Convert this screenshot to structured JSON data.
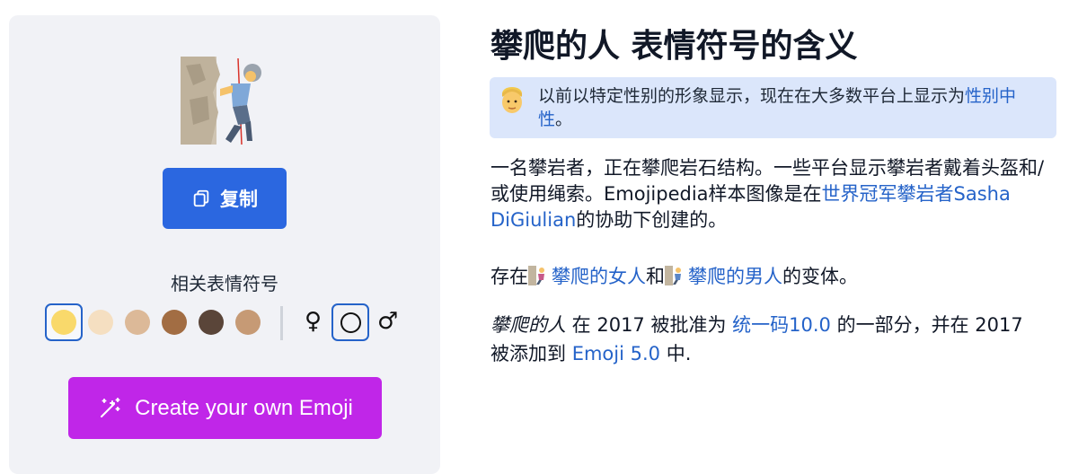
{
  "emoji": {
    "name": "攀爬的人",
    "icon": "person-climbing-icon"
  },
  "copy_button": {
    "label": "复制",
    "icon": "copy-icon"
  },
  "related": {
    "title": "相关表情符号",
    "skin_tones": [
      {
        "color": "#f9d96b",
        "selected": true
      },
      {
        "color": "#f5dfc1",
        "selected": false
      },
      {
        "color": "#dcb998",
        "selected": false
      },
      {
        "color": "#a26d43",
        "selected": false
      },
      {
        "color": "#5a4539",
        "selected": false
      },
      {
        "color": "#c69a75",
        "selected": false
      }
    ],
    "gender_female": "♀",
    "gender_male": "♂"
  },
  "create_button": {
    "label": "Create your own Emoji",
    "icon": "magic-wand-icon"
  },
  "page": {
    "title": "攀爬的人 表情符号的含义"
  },
  "notice": {
    "icon": "person-face-icon",
    "text": "以前以特定性别的形象显示，现在在大多数平台上显示为",
    "link": "性别中性",
    "tail": "。"
  },
  "description": {
    "text1": "一名攀岩者，正在攀爬岩石结构。一些平台显示攀岩者戴着头盔和/或使用绳索。Emojipedia样本图像是在",
    "link": "世界冠军攀岩者Sasha DiGiulian",
    "text2": "的协助下创建的。"
  },
  "variants": {
    "prefix": "存在",
    "woman_link": "攀爬的女人",
    "middle": "和",
    "man_link": "攀爬的男人",
    "suffix": "的变体。"
  },
  "approved": {
    "name": "攀爬的人",
    "t1": " 在 2017 被批准为 ",
    "unicode_link": "统一码10.0",
    "t2": " 的一部分，并在 2017 被添加到 ",
    "emoji_link": "Emoji 5.0",
    "t3": " 中."
  },
  "colors": {
    "card_bg": "#f1f2f6",
    "copy_button": "#2b67e0",
    "create_button": "#c026e8",
    "notice_bg": "#dbe6fb",
    "link": "#2563c9"
  }
}
